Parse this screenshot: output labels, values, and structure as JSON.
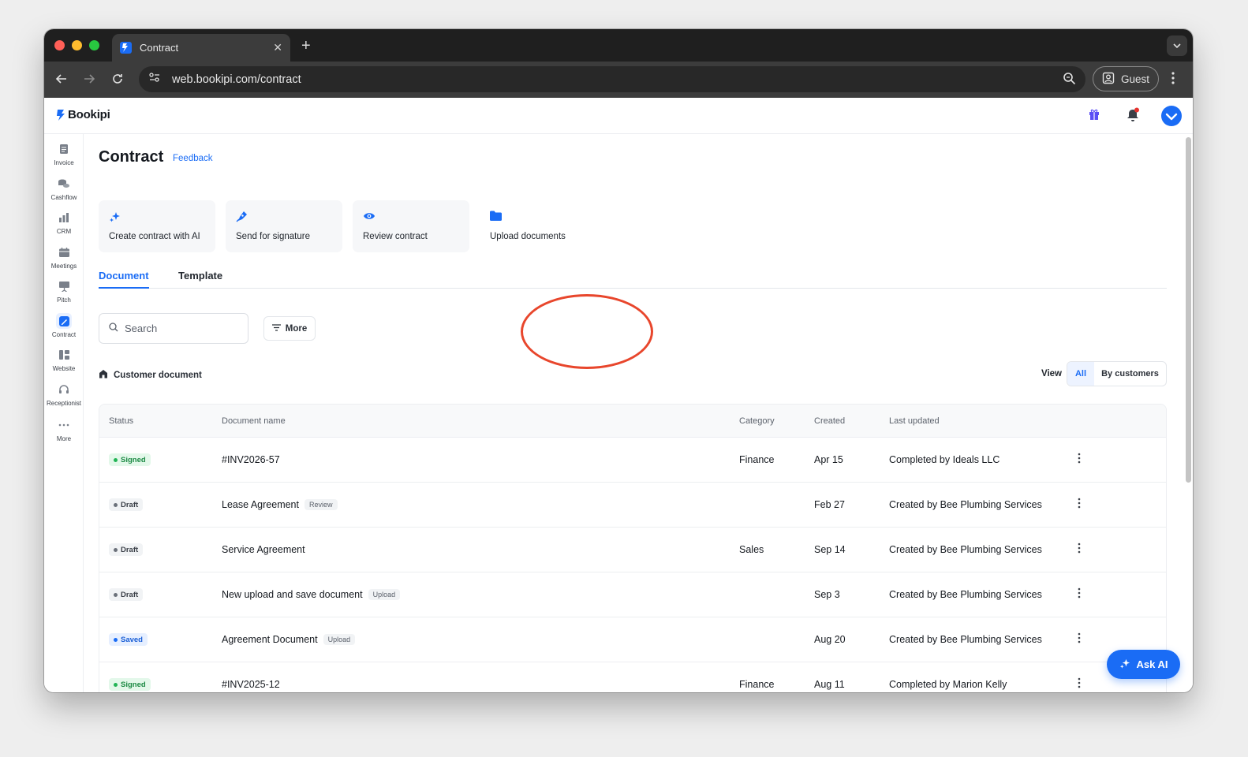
{
  "browser": {
    "tab_title": "Contract",
    "url": "web.bookipi.com/contract",
    "profile_label": "Guest"
  },
  "app": {
    "logo_text": "Bookipi",
    "brand_color": "#1a6cf5"
  },
  "sidebar": {
    "items": [
      {
        "label": "Invoice",
        "icon": "document-icon"
      },
      {
        "label": "Cashflow",
        "icon": "coins-icon"
      },
      {
        "label": "CRM",
        "icon": "bar-chart-icon"
      },
      {
        "label": "Meetings",
        "icon": "calendar-icon"
      },
      {
        "label": "Pitch",
        "icon": "presentation-icon"
      },
      {
        "label": "Contract",
        "icon": "contract-pen-icon",
        "active": true
      },
      {
        "label": "Website",
        "icon": "layout-icon"
      },
      {
        "label": "Receptionist",
        "icon": "headset-icon"
      },
      {
        "label": "More",
        "icon": "more-dots-icon"
      }
    ]
  },
  "page": {
    "title": "Contract",
    "feedback": "Feedback"
  },
  "actions": [
    {
      "label": "Create contract with AI",
      "icon": "sparkle-icon"
    },
    {
      "label": "Send for signature",
      "icon": "pen-nib-icon"
    },
    {
      "label": "Review contract",
      "icon": "eye-icon"
    },
    {
      "label": "Upload documents",
      "icon": "folder-icon"
    }
  ],
  "tabs": {
    "document": "Document",
    "template": "Template"
  },
  "filters": {
    "search_placeholder": "Search",
    "more_label": "More"
  },
  "section": {
    "title": "Customer document",
    "view_label": "View",
    "view_all": "All",
    "view_by_customers": "By customers"
  },
  "table": {
    "headers": {
      "status": "Status",
      "name": "Document name",
      "category": "Category",
      "created": "Created",
      "updated": "Last updated"
    },
    "rows": [
      {
        "status": "Signed",
        "name": "#INV2026-57",
        "tag": "",
        "category": "Finance",
        "created": "Apr 15",
        "updated": "Completed by Ideals LLC"
      },
      {
        "status": "Draft",
        "name": "Lease Agreement",
        "tag": "Review",
        "category": "",
        "created": "Feb 27",
        "updated": "Created by Bee Plumbing Services"
      },
      {
        "status": "Draft",
        "name": "Service Agreement",
        "tag": "",
        "category": "Sales",
        "created": "Sep 14",
        "updated": "Created by Bee Plumbing Services"
      },
      {
        "status": "Draft",
        "name": "New upload and save document",
        "tag": "Upload",
        "category": "",
        "created": "Sep 3",
        "updated": "Created by Bee Plumbing Services"
      },
      {
        "status": "Saved",
        "name": "Agreement Document",
        "tag": "Upload",
        "category": "",
        "created": "Aug 20",
        "updated": "Created by Bee Plumbing Services"
      },
      {
        "status": "Signed",
        "name": "#INV2025-12",
        "tag": "",
        "category": "Finance",
        "created": "Aug 11",
        "updated": "Completed by Marion Kelly"
      }
    ]
  },
  "ask_ai": "Ask AI",
  "status_colors": {
    "Signed": {
      "bg": "#e3f8ea",
      "fg": "#1c8a44",
      "dot": "#22b455"
    },
    "Draft": {
      "bg": "#f1f3f5",
      "fg": "#3a3f47",
      "dot": "#6b717a"
    },
    "Saved": {
      "bg": "#e6efff",
      "fg": "#1a5fd6",
      "dot": "#1a6cf5"
    }
  }
}
